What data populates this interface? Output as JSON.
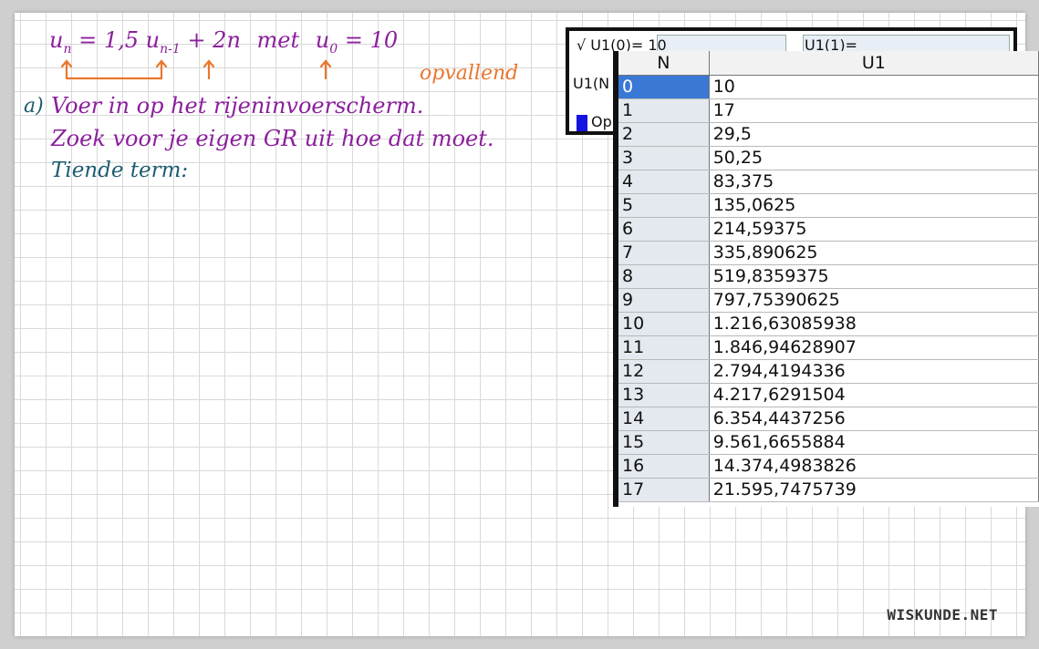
{
  "notes": {
    "formula": {
      "u": "u",
      "n_sub": "n",
      "eq1": "= 1,5 u",
      "nm1_sub": "n-1",
      "plus": "+ 2n",
      "met": "met",
      "u0": "u",
      "zero_sub": "0",
      "eq2": "= 10"
    },
    "highlight": "opvallend",
    "part_label": "a)",
    "line1": "Voer in op het rijeninvoerscherm.",
    "line2": "Zoek voor je eigen GR uit hoe dat moet.",
    "line3": "Tiende term:"
  },
  "calculator": {
    "input_row": "√ U1(0)= 10",
    "input_row_right": "U1(1)=",
    "row2": "U1(N",
    "row3": "Op"
  },
  "table": {
    "headers": [
      "N",
      "U1"
    ],
    "rows": [
      {
        "n": "0",
        "u1": "10"
      },
      {
        "n": "1",
        "u1": "17"
      },
      {
        "n": "2",
        "u1": "29,5"
      },
      {
        "n": "3",
        "u1": "50,25"
      },
      {
        "n": "4",
        "u1": "83,375"
      },
      {
        "n": "5",
        "u1": "135,0625"
      },
      {
        "n": "6",
        "u1": "214,59375"
      },
      {
        "n": "7",
        "u1": "335,890625"
      },
      {
        "n": "8",
        "u1": "519,8359375"
      },
      {
        "n": "9",
        "u1": "797,75390625"
      },
      {
        "n": "10",
        "u1": "1.216,63085938"
      },
      {
        "n": "11",
        "u1": "1.846,94628907"
      },
      {
        "n": "12",
        "u1": "2.794,4194336"
      },
      {
        "n": "13",
        "u1": "4.217,6291504"
      },
      {
        "n": "14",
        "u1": "6.354,4437256"
      },
      {
        "n": "15",
        "u1": "9.561,6655884"
      },
      {
        "n": "16",
        "u1": "14.374,4983826"
      },
      {
        "n": "17",
        "u1": "21.595,7475739"
      }
    ]
  },
  "watermark": "WISKUNDE.NET",
  "colors": {
    "formula": "#8b1f9c",
    "arrows": "#e9772d",
    "text": "#1d5c70",
    "selected_row": "#3a78d6"
  }
}
